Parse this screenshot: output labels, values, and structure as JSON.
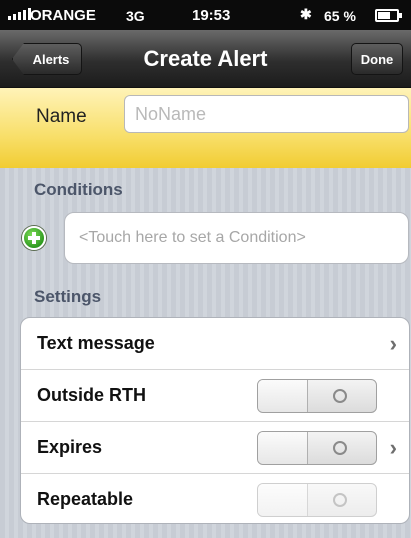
{
  "status_bar": {
    "carrier": "ORANGE",
    "network": "3G",
    "time": "19:53",
    "bluetooth_icon": "bluetooth-icon",
    "battery_text": "65 %",
    "battery_level": 0.65
  },
  "nav": {
    "back_label": "Alerts",
    "title": "Create Alert",
    "done_label": "Done"
  },
  "name": {
    "label": "Name",
    "placeholder": "NoName",
    "value": ""
  },
  "conditions": {
    "header": "Conditions",
    "add_icon": "add-icon",
    "placeholder": "<Touch here to set a Condition>"
  },
  "settings": {
    "header": "Settings",
    "rows": [
      {
        "label": "Text message",
        "has_chevron": true
      },
      {
        "label": "Outside RTH",
        "toggle": "off"
      },
      {
        "label": "Expires",
        "toggle": "off",
        "has_chevron": true
      },
      {
        "label": "Repeatable",
        "toggle": "off",
        "disabled": true
      }
    ]
  },
  "colors": {
    "name_band_yellow": "#f8df6a",
    "nav_dark": "#2e2e2e",
    "add_green": "#2f9a1f",
    "section_header": "#4c566a"
  }
}
